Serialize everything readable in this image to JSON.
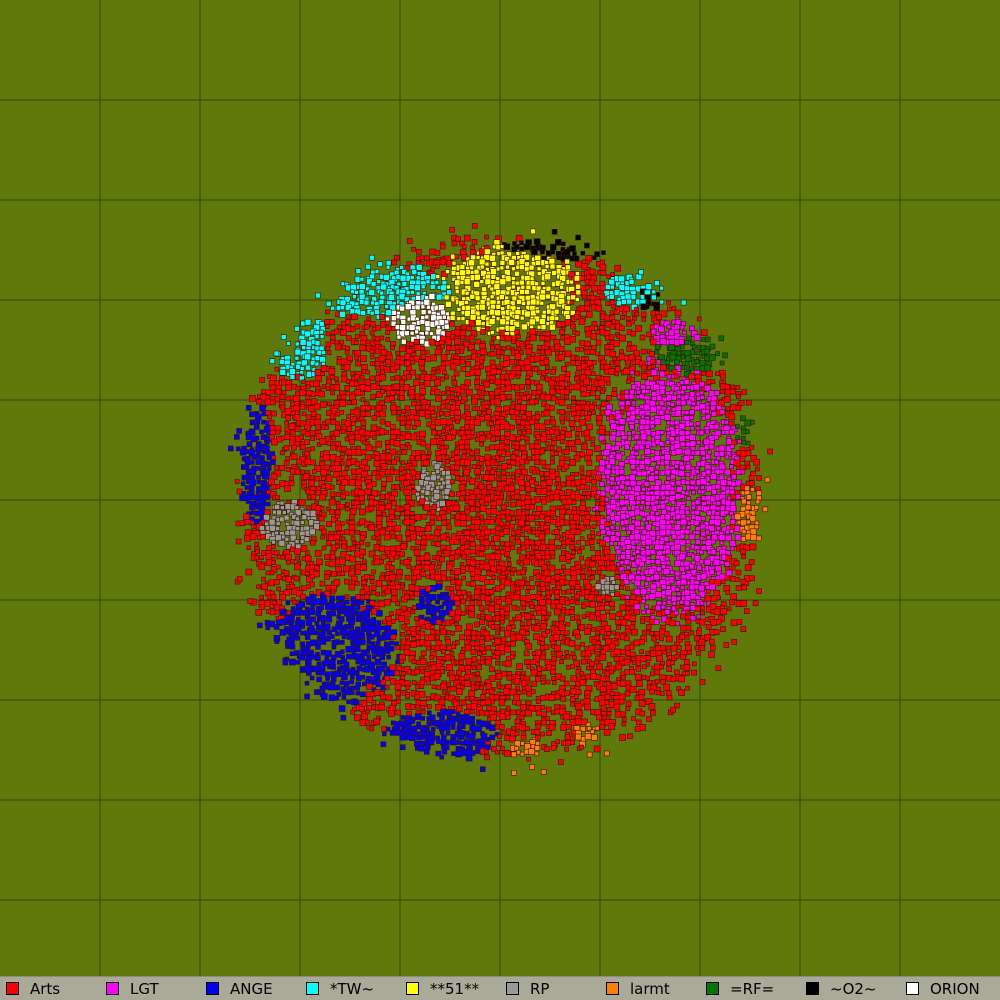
{
  "map": {
    "background_color": "#5f7a0b",
    "grid_color": "#2f4a08",
    "empty_cell_color": "#5f7a0b",
    "territory_style": "galaxy ownership map, sectors drawn as small squares"
  },
  "legend": {
    "background_color": "#aaaa99",
    "entries": [
      {
        "label": "Arts",
        "color": "#ff0000"
      },
      {
        "label": "LGT",
        "color": "#ff00ff"
      },
      {
        "label": "ANGE",
        "color": "#0000ff"
      },
      {
        "label": "*TW~",
        "color": "#00ffff"
      },
      {
        "label": "**51**",
        "color": "#ffff00"
      },
      {
        "label": "RP",
        "color": "#999999"
      },
      {
        "label": "larmt",
        "color": "#ff8000"
      },
      {
        "label": "=RF=",
        "color": "#007700"
      },
      {
        "label": "~O2~",
        "color": "#000000"
      },
      {
        "label": "ORION",
        "color": "#ffffff"
      }
    ]
  }
}
